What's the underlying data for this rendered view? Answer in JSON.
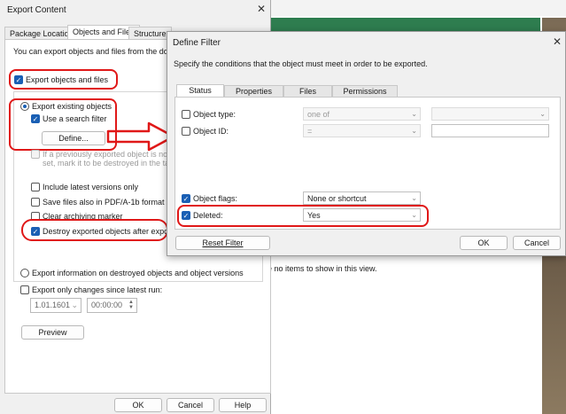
{
  "background": {
    "empty_text": "e no items to show in this view."
  },
  "export_dialog": {
    "title": "Export Content",
    "tabs": [
      "Package Location",
      "Objects and Files",
      "Structure"
    ],
    "intro": "You can export objects and files from the docu",
    "export_objects_label": "Export objects and files",
    "export_existing_label": "Export existing objects",
    "use_search_filter_label": "Use a search filter",
    "define_label": "Define...",
    "previously_exported_line1": "If a previously exported object is no lo",
    "previously_exported_line2": "set, mark it to be destroyed in the tar",
    "include_latest_label": "Include latest versions only",
    "save_pdfa_label": "Save files also in PDF/A-1b format",
    "clear_archiving_label": "Clear archiving marker",
    "destroy_exported_label": "Destroy exported objects after export",
    "export_info_destroyed_label": "Export information on destroyed objects and object versions",
    "export_only_changes_label": "Export only changes since latest run:",
    "date_value": "1.01.1601",
    "time_value": "00:00:00",
    "preview_label": "Preview",
    "ok_label": "OK",
    "cancel_label": "Cancel",
    "help_label": "Help"
  },
  "filter_dialog": {
    "title": "Define Filter",
    "description": "Specify the conditions that the object must meet in order to be exported.",
    "tabs": [
      "Status",
      "Properties",
      "Files",
      "Permissions"
    ],
    "object_type_label": "Object type:",
    "object_type_op": "one of",
    "object_id_label": "Object ID:",
    "object_id_op": "=",
    "object_flags_label": "Object flags:",
    "object_flags_value": "None or shortcut",
    "deleted_label": "Deleted:",
    "deleted_value": "Yes",
    "reset_label": "Reset Filter",
    "ok_label": "OK",
    "cancel_label": "Cancel"
  },
  "colors": {
    "annotation_red": "#e01818",
    "accent_blue": "#1a5fb4",
    "header_green": "#2e7d4f"
  }
}
